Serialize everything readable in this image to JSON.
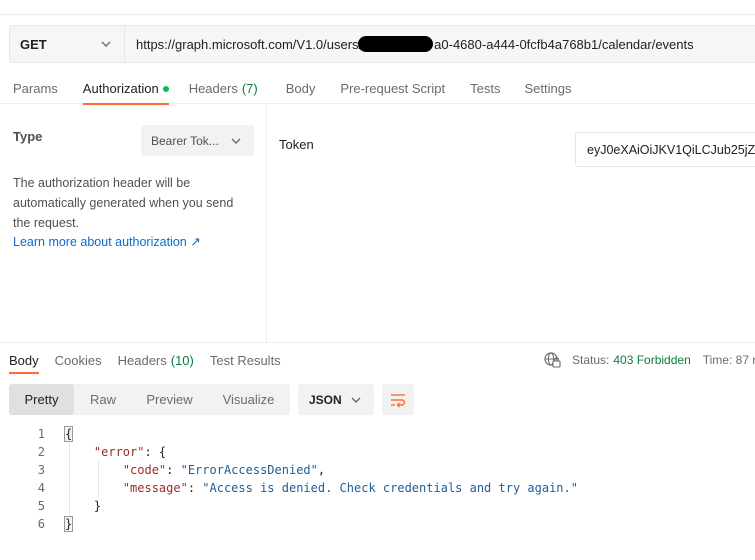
{
  "request": {
    "method": "GET",
    "url_prefix": "https://graph.microsoft.com/V1.0/users/",
    "url_suffix": "a0-4680-a444-0fcfb4a768b1/calendar/events"
  },
  "request_tabs": [
    {
      "label": "Params",
      "active": false
    },
    {
      "label": "Authorization",
      "active": true,
      "dot": true
    },
    {
      "label": "Headers",
      "count": "(7)",
      "active": false
    },
    {
      "label": "Body",
      "active": false
    },
    {
      "label": "Pre-request Script",
      "active": false
    },
    {
      "label": "Tests",
      "active": false
    },
    {
      "label": "Settings",
      "active": false
    }
  ],
  "auth": {
    "type_label": "Type",
    "type_value": "Bearer Tok...",
    "description": "The authorization header will be automatically generated when you send the request.",
    "learn_more": "Learn more about authorization ↗",
    "token_label": "Token",
    "token_value": "eyJ0eXAiOiJKV1QiLCJub25jZS"
  },
  "response_tabs": [
    {
      "label": "Body",
      "active": true
    },
    {
      "label": "Cookies",
      "active": false
    },
    {
      "label": "Headers",
      "count": "(10)",
      "active": false
    },
    {
      "label": "Test Results",
      "active": false
    }
  ],
  "response_status": {
    "status_label": "Status:",
    "status_value": "403 Forbidden",
    "time_label": "Time: 87 m"
  },
  "view_tabs": [
    {
      "label": "Pretty",
      "active": true
    },
    {
      "label": "Raw",
      "active": false
    },
    {
      "label": "Preview",
      "active": false
    },
    {
      "label": "Visualize",
      "active": false
    }
  ],
  "format": "JSON",
  "code_lines": [
    {
      "num": "1",
      "open_brace": "{"
    },
    {
      "num": "2",
      "key": "\"error\"",
      "rest": ": {"
    },
    {
      "num": "3",
      "key": "\"code\"",
      "sep": ": ",
      "value": "\"ErrorAccessDenied\"",
      "tail": ","
    },
    {
      "num": "4",
      "key": "\"message\"",
      "sep": ": ",
      "value": "\"Access is denied. Check credentials and try again.\"",
      "tail": ""
    },
    {
      "num": "5",
      "close": "}"
    },
    {
      "num": "6",
      "close_brace": "}"
    }
  ],
  "colors": {
    "accent": "#ff6c37",
    "success": "#0a7d3c",
    "link": "#0b6bcb",
    "json_key": "#9c2b2b",
    "json_string": "#1f5e99"
  }
}
